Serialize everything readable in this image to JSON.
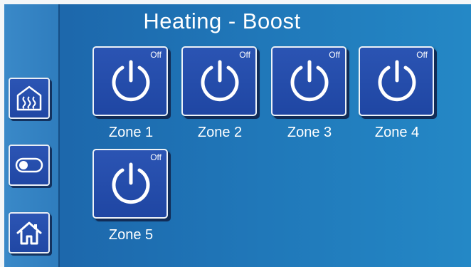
{
  "header": {
    "title": "Heating - Boost"
  },
  "sidebar": {
    "items": [
      {
        "icon": "heating-house-icon"
      },
      {
        "icon": "toggle-switch-icon"
      },
      {
        "icon": "home-icon"
      }
    ]
  },
  "zones": [
    {
      "label": "Zone 1",
      "state": "Off",
      "icon": "power-icon"
    },
    {
      "label": "Zone 2",
      "state": "Off",
      "icon": "power-icon"
    },
    {
      "label": "Zone 3",
      "state": "Off",
      "icon": "power-icon"
    },
    {
      "label": "Zone 4",
      "state": "Off",
      "icon": "power-icon"
    },
    {
      "label": "Zone 5",
      "state": "Off",
      "icon": "power-icon"
    }
  ],
  "colors": {
    "background": "#1f74b6",
    "sidebar": "#3a89c8",
    "button": "#2047a4",
    "text": "#ffffff"
  }
}
